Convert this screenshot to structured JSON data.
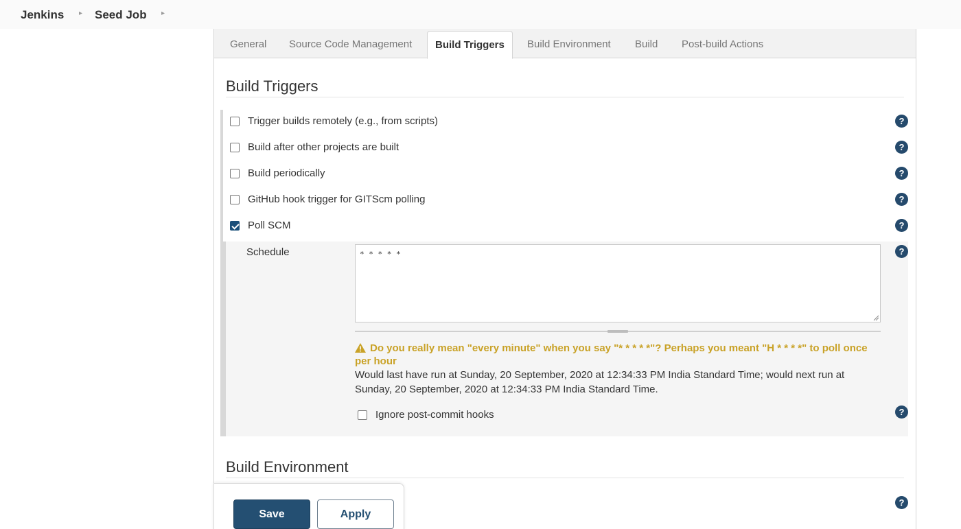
{
  "breadcrumb": {
    "items": [
      "Jenkins",
      "Seed Job"
    ]
  },
  "tabs": [
    {
      "label": "General",
      "active": false
    },
    {
      "label": "Source Code Management",
      "active": false
    },
    {
      "label": "Build Triggers",
      "active": true
    },
    {
      "label": "Build Environment",
      "active": false
    },
    {
      "label": "Build",
      "active": false
    },
    {
      "label": "Post-build Actions",
      "active": false
    }
  ],
  "build_triggers": {
    "title": "Build Triggers",
    "options": [
      {
        "label": "Trigger builds remotely (e.g., from scripts)",
        "checked": false
      },
      {
        "label": "Build after other projects are built",
        "checked": false
      },
      {
        "label": "Build periodically",
        "checked": false
      },
      {
        "label": "GitHub hook trigger for GITScm polling",
        "checked": false
      },
      {
        "label": "Poll SCM",
        "checked": true
      }
    ],
    "schedule": {
      "label": "Schedule",
      "value": "* * * * *",
      "warning": "Do you really mean \"every minute\" when you say \"* * * * *\"? Perhaps you meant \"H * * * *\" to poll once per hour",
      "info": "Would last have run at Sunday, 20 September, 2020 at 12:34:33 PM India Standard Time; would next run at Sunday, 20 September, 2020 at 12:34:33 PM India Standard Time."
    },
    "ignore_post_commit": {
      "label": "Ignore post-commit hooks",
      "checked": false
    }
  },
  "build_environment": {
    "title": "Build Environment"
  },
  "actions": {
    "save_label": "Save",
    "apply_label": "Apply"
  },
  "colors": {
    "primary": "#244f72",
    "warning": "#c9a227",
    "help_icon": "#254a6c"
  },
  "icons": {
    "help": "question-circle-icon",
    "warning": "warning-triangle-icon",
    "breadcrumb_separator": "caret-right-icon"
  }
}
